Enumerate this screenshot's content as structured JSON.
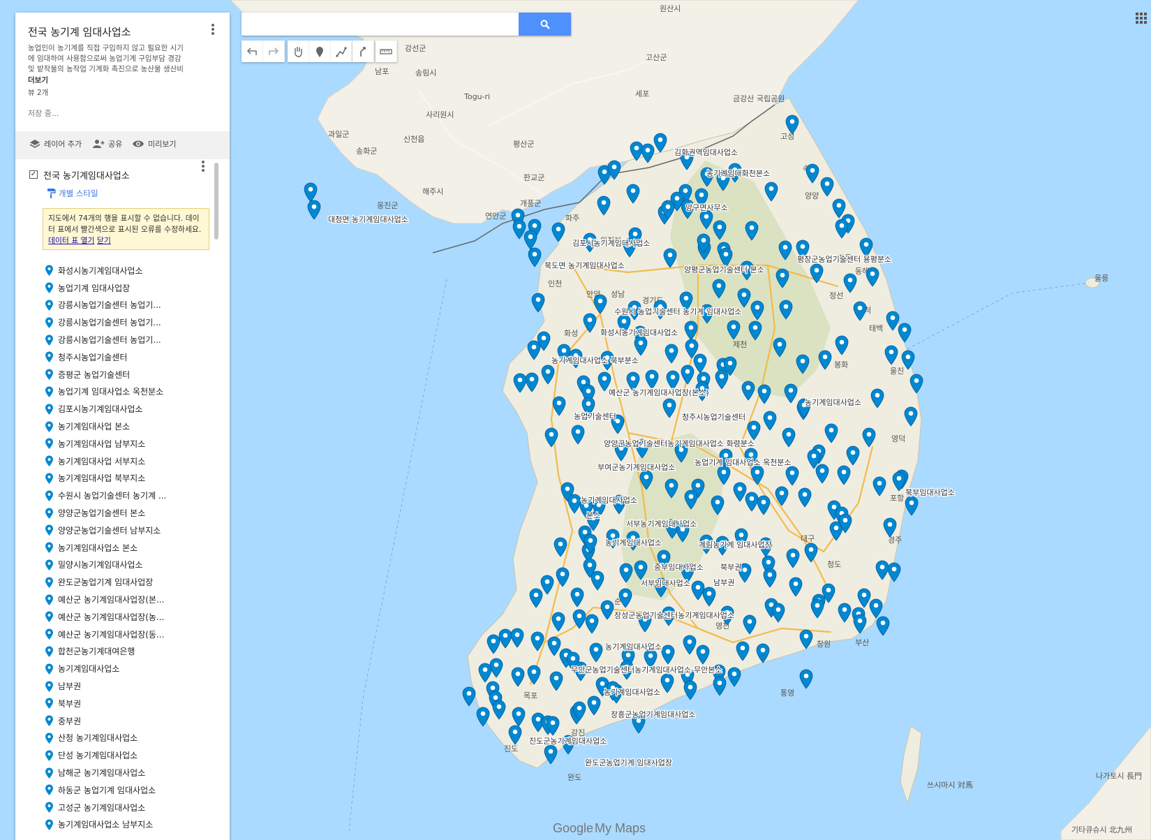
{
  "sidebar": {
    "title": "전국 농기계 임대사업소",
    "description": "농업인이 농기계를 직접 구입하지 않고 필요한 시기\n에 임대하여 사용함으로써 농업기계 구입부담 경감\n및 밭작물의 농작업 기계화 촉진으로 농산물 생산비",
    "more_label": "더보기",
    "views": "뷰 2개",
    "saving_status": "저장 중...",
    "toolbar": {
      "add_layer": "레이어 추가",
      "share": "공유",
      "preview": "미리보기"
    },
    "layer": {
      "name": "전국 농기계임대사업소",
      "checked": true,
      "style_label": "개별 스타일",
      "warning_text": "지도에서 74개의 행을 표시할 수 없습니다. 데이터 표에서 빨간색으로 표시된 오류를 수정하세요.",
      "warning_link": "데이터 표 열기",
      "warning_close": "닫기"
    },
    "items": [
      "화성시농기계임대사업소",
      "농업기계 임대사업장",
      "강릉시농업기술센터 농업기...",
      "강릉시농업기술센터 농업기...",
      "강릉시농업기술센터 농업기...",
      "청주시농업기술센터",
      "증평군 농업기술센터",
      "농업기계 임대사업소 옥천분소",
      "김포시농기계임대사업소",
      "농기계임대사업 본소",
      "농기계임대사업 남부지소",
      "농기계임대사업 서부지소",
      "농기계임대사업 북부지소",
      "수원시 농업기술센터 농기계 ...",
      "양양군농업기술센터 본소",
      "양양군농업기술센터 남부지소",
      "농기계임대사업소 본소",
      "밀양시농기계임대사업소",
      "완도군농업기계 임대사업장",
      "예산군 농기계임대사업장(본...",
      "예산군 농기계임대사업장(농...",
      "예산군 농기계임대사업장(동...",
      "합천군농기계대여은행",
      "농기계임대사업소",
      "남부권",
      "북부권",
      "중부권",
      "산청 농기계임대사업소",
      "단성 농기계임대사업소",
      "남해군 농기계임대사업소",
      "하동군 농업기계 임대사업소",
      "고성군 농기계임대사업소",
      "농기계임대사업소 남부지소"
    ]
  },
  "search": {
    "placeholder": "",
    "value": ""
  },
  "map_tools": [
    "undo-icon",
    "redo-icon",
    "hand-icon",
    "marker-icon",
    "line-icon",
    "route-icon",
    "ruler-icon"
  ],
  "map": {
    "place_labels": [
      "원산시",
      "강선군",
      "고산군",
      "남포",
      "송림시",
      "Togu-ri",
      "사리원시",
      "세포",
      "금강산 국립공원",
      "과일군",
      "송화군",
      "신천읍",
      "평산군",
      "판교군",
      "해주시",
      "옹진군",
      "개풍군",
      "연안군",
      "고성",
      "속초",
      "양양",
      "파주",
      "의정부",
      "인천",
      "안양",
      "성남",
      "경기도",
      "화성",
      "강릉",
      "동해",
      "정선",
      "삼척",
      "제천",
      "태백",
      "봉화",
      "울진",
      "영덕",
      "포항",
      "대구",
      "경주",
      "청도",
      "부산",
      "창원",
      "통영",
      "목포",
      "완도",
      "진도",
      "강진",
      "순천",
      "울릉",
      "영천",
      "쓰시마시 対馬",
      "나가토시 長門",
      "기타큐슈시 北九州"
    ],
    "marker_labels": [
      "김화권역임대사업소",
      "농기계임대화천본소",
      "양구면사무소",
      "대청면 농기계임대사업소",
      "김포시농기계임대사업소",
      "북도면 농기계임대사업소",
      "양평군농업기술센터 본소",
      "평창군농업기술센터 용평분소",
      "수원시 농업기술센터 농기계 임대사업소",
      "화성시농기계임대사업소",
      "농기계임대사업소 북부분소",
      "예산군 농기계임대사업장(본소)",
      "농업기술센터",
      "청주시농업기술센터",
      "농기계임대사업소",
      "양양군농업기술센터농기계임대사업소 화령분소",
      "농업기계 임대사업소 옥천분소",
      "부여군농기계임대사업소",
      "북부임대사업소",
      "농기계임대사업소",
      "본소",
      "서부농기계임대사업소",
      "농기계임대사업소",
      "계림농기계 임대사업장",
      "중부임대사업소",
      "북부권",
      "서부임대사업소",
      "남부권",
      "장성군농업기술센터농기계임대사업소",
      "농기계임대사업소",
      "무안군농업기술센터농기계임대사업소-무안본소",
      "농기계임대사업소",
      "장흥군농업기계임대사업소",
      "진도군농기계임대사업소",
      "완도군농업기계 임대사업장"
    ],
    "branding": {
      "google": "Google",
      "product": "My Maps"
    }
  }
}
